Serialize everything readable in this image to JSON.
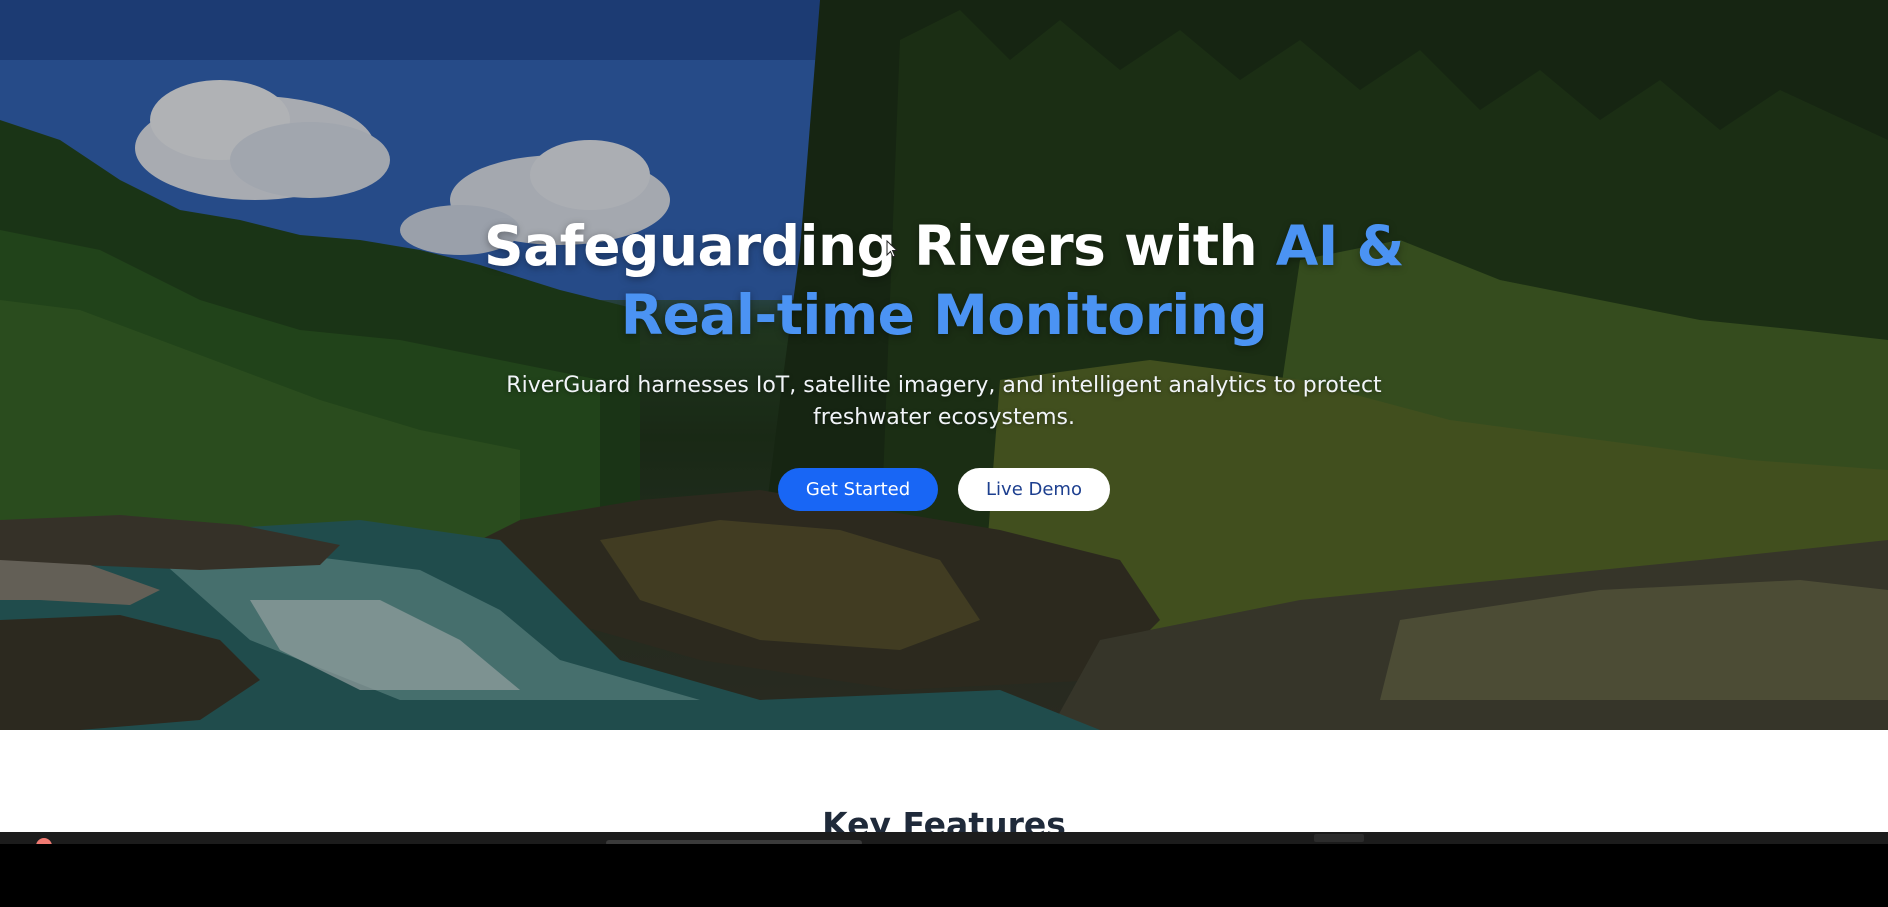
{
  "hero": {
    "headline_line1": "Safeguarding Rivers with ",
    "headline_accent1": "AI &",
    "headline_accent2": "Real-time Monitoring",
    "subtitle": "RiverGuard harnesses IoT, satellite imagery, and intelligent analytics to protect freshwater ecosystems.",
    "primary_button": "Get Started",
    "secondary_button": "Live Demo"
  },
  "features": {
    "title": "Key Features"
  },
  "colors": {
    "accent": "#4b93f3",
    "primary_button_bg": "#1866f5",
    "secondary_button_text": "#1d3f8f",
    "title_text": "#1f2a3a"
  },
  "icons": {
    "cursor": "mouse-cursor-icon"
  }
}
